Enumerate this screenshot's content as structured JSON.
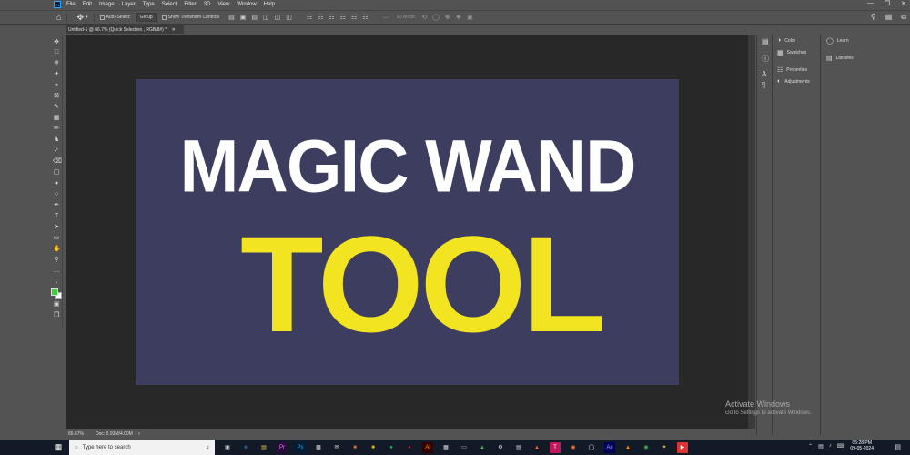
{
  "menubar": {
    "items": [
      "File",
      "Edit",
      "Image",
      "Layer",
      "Type",
      "Select",
      "Filter",
      "3D",
      "View",
      "Window",
      "Help"
    ],
    "logo_text": "Ps"
  },
  "optionsbar": {
    "auto_select_label": "Auto-Select:",
    "group_select": "Group",
    "transform_label": "Show Transform Controls",
    "mode_3d": "3D Mode:"
  },
  "doctab": {
    "label": "Untitled-1 @ 66.7% (Quick Selection , RGB/8#) *"
  },
  "artboard": {
    "background": "#3d3d5f",
    "line1": "MAGIC WAND",
    "line2": "TOOL",
    "line1_color": "#ffffff",
    "line2_color": "#f2e421"
  },
  "statusbar": {
    "zoom": "66.67%",
    "doc_info": "Doc: 5.93M/4.00M"
  },
  "panels": {
    "col1": [
      "Color",
      "Swatches",
      "Properties",
      "Adjustments"
    ],
    "col2": [
      "Learn",
      "Libraries"
    ]
  },
  "watermark": {
    "line1": "Activate Windows",
    "line2": "Go to Settings to activate Windows."
  },
  "taskbar": {
    "search_placeholder": "Type here to search",
    "time": "05:28 PM",
    "date": "09-05-2024"
  },
  "colors": {
    "foreground_swatch": "#3ad13a",
    "background_swatch": "#ffffff"
  }
}
